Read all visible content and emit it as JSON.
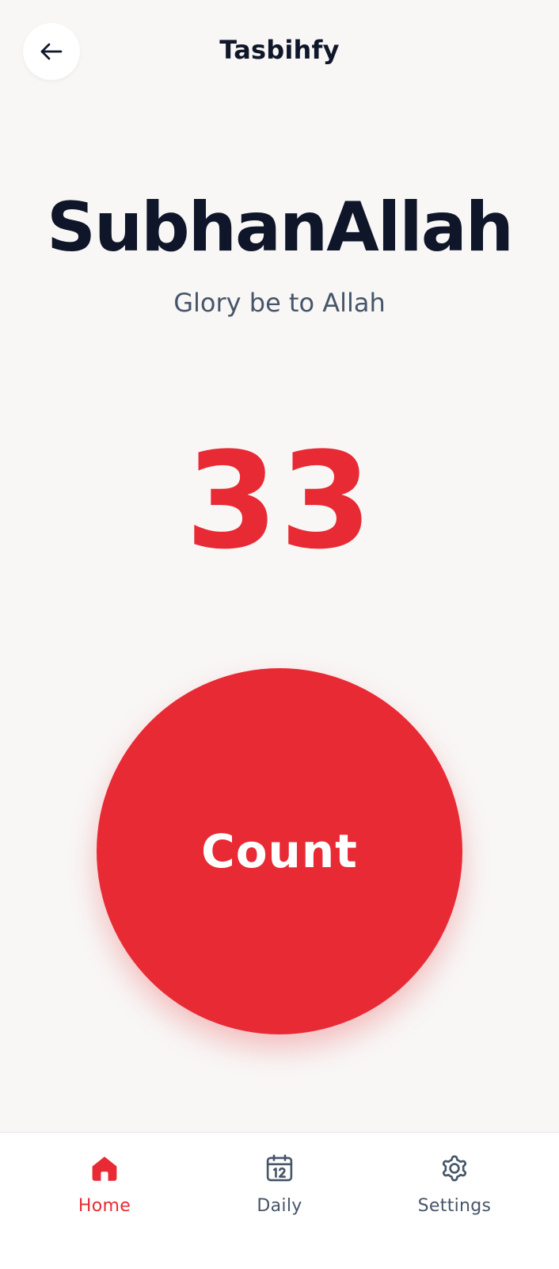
{
  "colors": {
    "accent": "#e82a34",
    "title": "#0f1629",
    "muted": "#475569",
    "background": "#f8f7f6"
  },
  "header": {
    "back_icon": "arrow-left-icon",
    "title": "Tasbihfy"
  },
  "dhikr": {
    "arabic_transliteration": "SubhanAllah",
    "translation": "Glory be to Allah"
  },
  "counter": {
    "value": "33"
  },
  "count_button": {
    "label": "Count"
  },
  "bottom_nav": {
    "items": [
      {
        "label": "Home",
        "icon": "home-icon",
        "active": true
      },
      {
        "label": "Daily",
        "icon": "calendar-icon",
        "active": false
      },
      {
        "label": "Settings",
        "icon": "gear-icon",
        "active": false
      }
    ]
  }
}
